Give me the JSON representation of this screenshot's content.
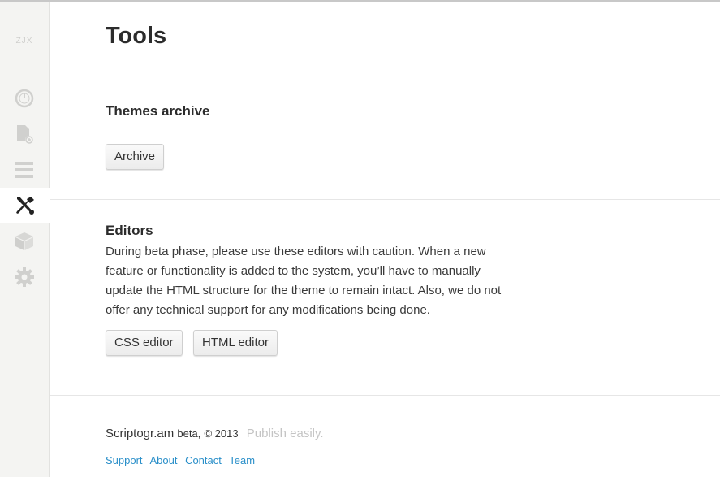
{
  "sidebar": {
    "logo": "ZJX",
    "items": [
      {
        "icon": "dashboard-icon",
        "active": false
      },
      {
        "icon": "new-post-icon",
        "active": false
      },
      {
        "icon": "list-icon",
        "active": false
      },
      {
        "icon": "tools-icon",
        "active": true
      },
      {
        "icon": "package-icon",
        "active": false
      },
      {
        "icon": "gear-icon",
        "active": false
      }
    ]
  },
  "page": {
    "title": "Tools"
  },
  "themes": {
    "heading": "Themes archive",
    "archive_button": "Archive"
  },
  "editors": {
    "heading": "Editors",
    "description": "During beta phase, please use these editors with caution. When a new feature or functionality is added to the system, you’ll have to manually update the HTML structure for the theme to remain intact. Also, we do not offer any technical support for any modifications being done.",
    "css_button": "CSS editor",
    "html_button": "HTML editor"
  },
  "footer": {
    "brand": "Scriptogr.am",
    "beta": "beta,",
    "copyright": "© 2013",
    "tagline": "Publish easily.",
    "links": [
      "Support",
      "About",
      "Contact",
      "Team"
    ]
  },
  "colors": {
    "accent_link": "#2a8fc9",
    "sidebar_bg": "#f4f4f2",
    "icon_gray": "#d0d0ce",
    "icon_active": "#222222"
  }
}
